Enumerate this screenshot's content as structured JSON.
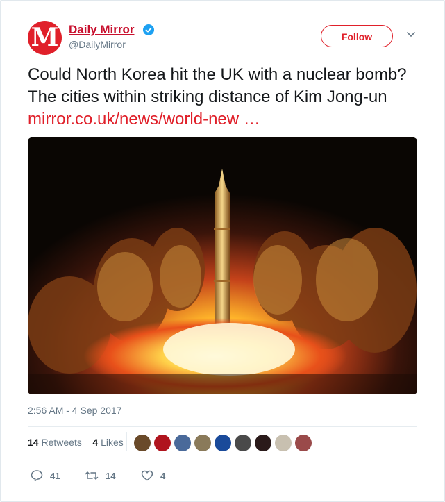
{
  "account": {
    "name": "Daily Mirror",
    "handle": "@DailyMirror",
    "avatar_letter": "M",
    "brand_color": "#e0202a",
    "verified": true
  },
  "header": {
    "follow_label": "Follow",
    "menu_icon": "chevron-down-icon"
  },
  "tweet": {
    "text": "Could North Korea hit the UK with a nuclear bomb? The cities within striking distance of Kim Jong-un ",
    "link": "mirror.co.uk/news/world-new …",
    "timestamp": "2:56 AM - 4 Sep 2017"
  },
  "stats": {
    "retweets_count": "14",
    "retweets_label": "Retweets",
    "likes_count": "4",
    "likes_label": "Likes"
  },
  "actions": {
    "reply_count": "41",
    "retweet_count": "14",
    "like_count": "4"
  },
  "colors": {
    "link": "#e0202a",
    "secondary_text": "#657786",
    "verified": "#1da1f2"
  }
}
